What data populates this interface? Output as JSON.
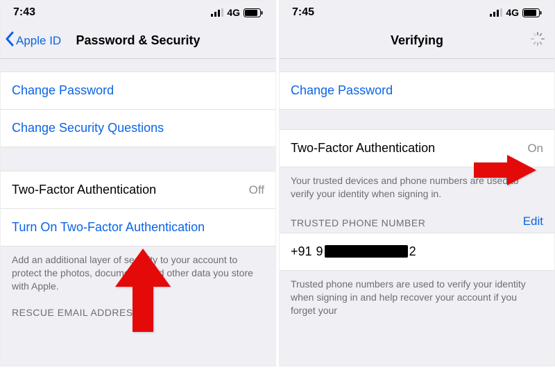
{
  "left": {
    "status": {
      "time": "7:43",
      "network": "4G"
    },
    "nav": {
      "back": "Apple ID",
      "title": "Password & Security"
    },
    "rows": {
      "change_password": "Change Password",
      "change_questions": "Change Security Questions",
      "two_factor_label": "Two-Factor Authentication",
      "two_factor_value": "Off",
      "turn_on_2fa": "Turn On Two-Factor Authentication"
    },
    "footer_2fa": "Add an additional layer of security to your account to protect the photos, documents, and other data you store with Apple.",
    "rescue_header": "RESCUE EMAIL ADDRESS"
  },
  "right": {
    "status": {
      "time": "7:45",
      "network": "4G"
    },
    "nav": {
      "title": "Verifying"
    },
    "rows": {
      "change_password": "Change Password",
      "two_factor_label": "Two-Factor Authentication",
      "two_factor_value": "On"
    },
    "trusted_desc": "Your trusted devices and phone numbers are used to verify your identity when signing in.",
    "trusted_header": "TRUSTED PHONE NUMBER",
    "edit": "Edit",
    "phone_prefix": "+91",
    "phone_suffix": "2",
    "trusted_footer": "Trusted phone numbers are used to verify your identity when signing in and help recover your account if you forget your"
  }
}
